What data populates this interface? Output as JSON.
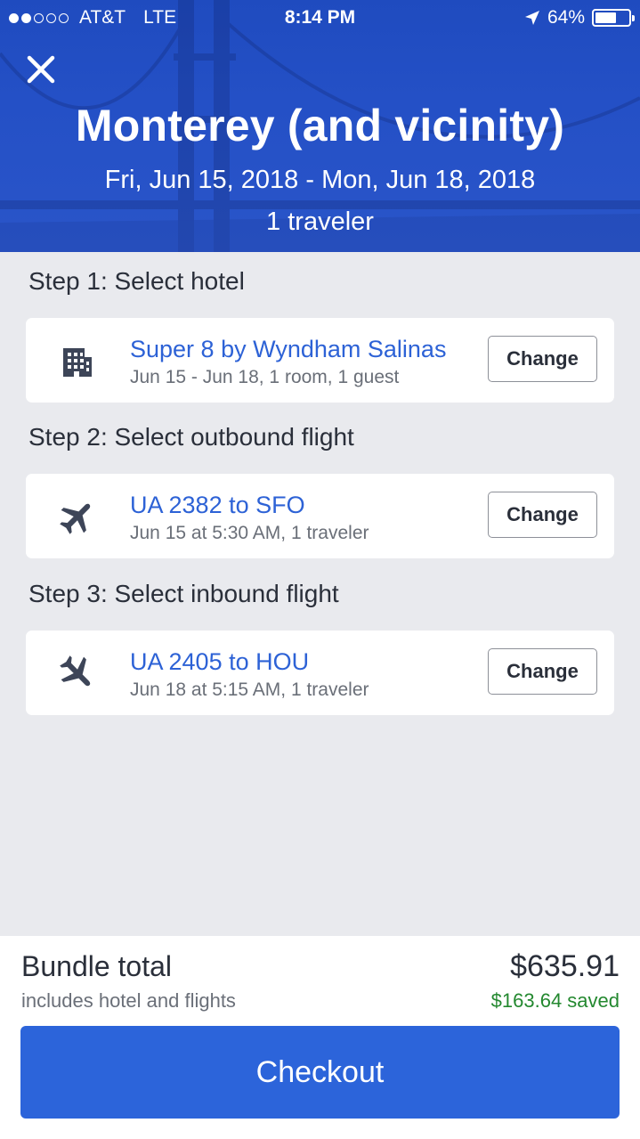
{
  "status_bar": {
    "carrier": "AT&T",
    "network": "LTE",
    "time": "8:14 PM",
    "battery": "64%",
    "battery_level": 0.64,
    "signal_bars_filled": 2,
    "signal_bars_total": 5
  },
  "header": {
    "title": "Monterey (and vicinity)",
    "dates": "Fri, Jun 15, 2018 - Mon, Jun 18, 2018",
    "travelers": "1 traveler",
    "background_color": "#2450c6"
  },
  "steps": [
    {
      "heading": "Step 1: Select hotel",
      "icon": "hotel-building-icon",
      "title": "Super 8 by Wyndham Salinas",
      "subtitle": "Jun 15 - Jun 18, 1 room, 1 guest",
      "button": "Change"
    },
    {
      "heading": "Step 2: Select outbound flight",
      "icon": "airplane-icon",
      "title": "UA 2382 to SFO",
      "subtitle": "Jun 15 at 5:30 AM, 1 traveler",
      "button": "Change"
    },
    {
      "heading": "Step 3: Select inbound flight",
      "icon": "airplane-icon",
      "title": "UA 2405 to HOU",
      "subtitle": "Jun 18 at 5:15 AM, 1 traveler",
      "button": "Change"
    }
  ],
  "footer": {
    "bundle_label": "Bundle total",
    "bundle_sub": "includes hotel and flights",
    "price": "$635.91",
    "saved": "$163.64 saved",
    "checkout": "Checkout"
  },
  "colors": {
    "accent": "#2c64da",
    "link": "#2d62d6",
    "saved": "#23882f",
    "page_bg": "#e9eaee"
  }
}
